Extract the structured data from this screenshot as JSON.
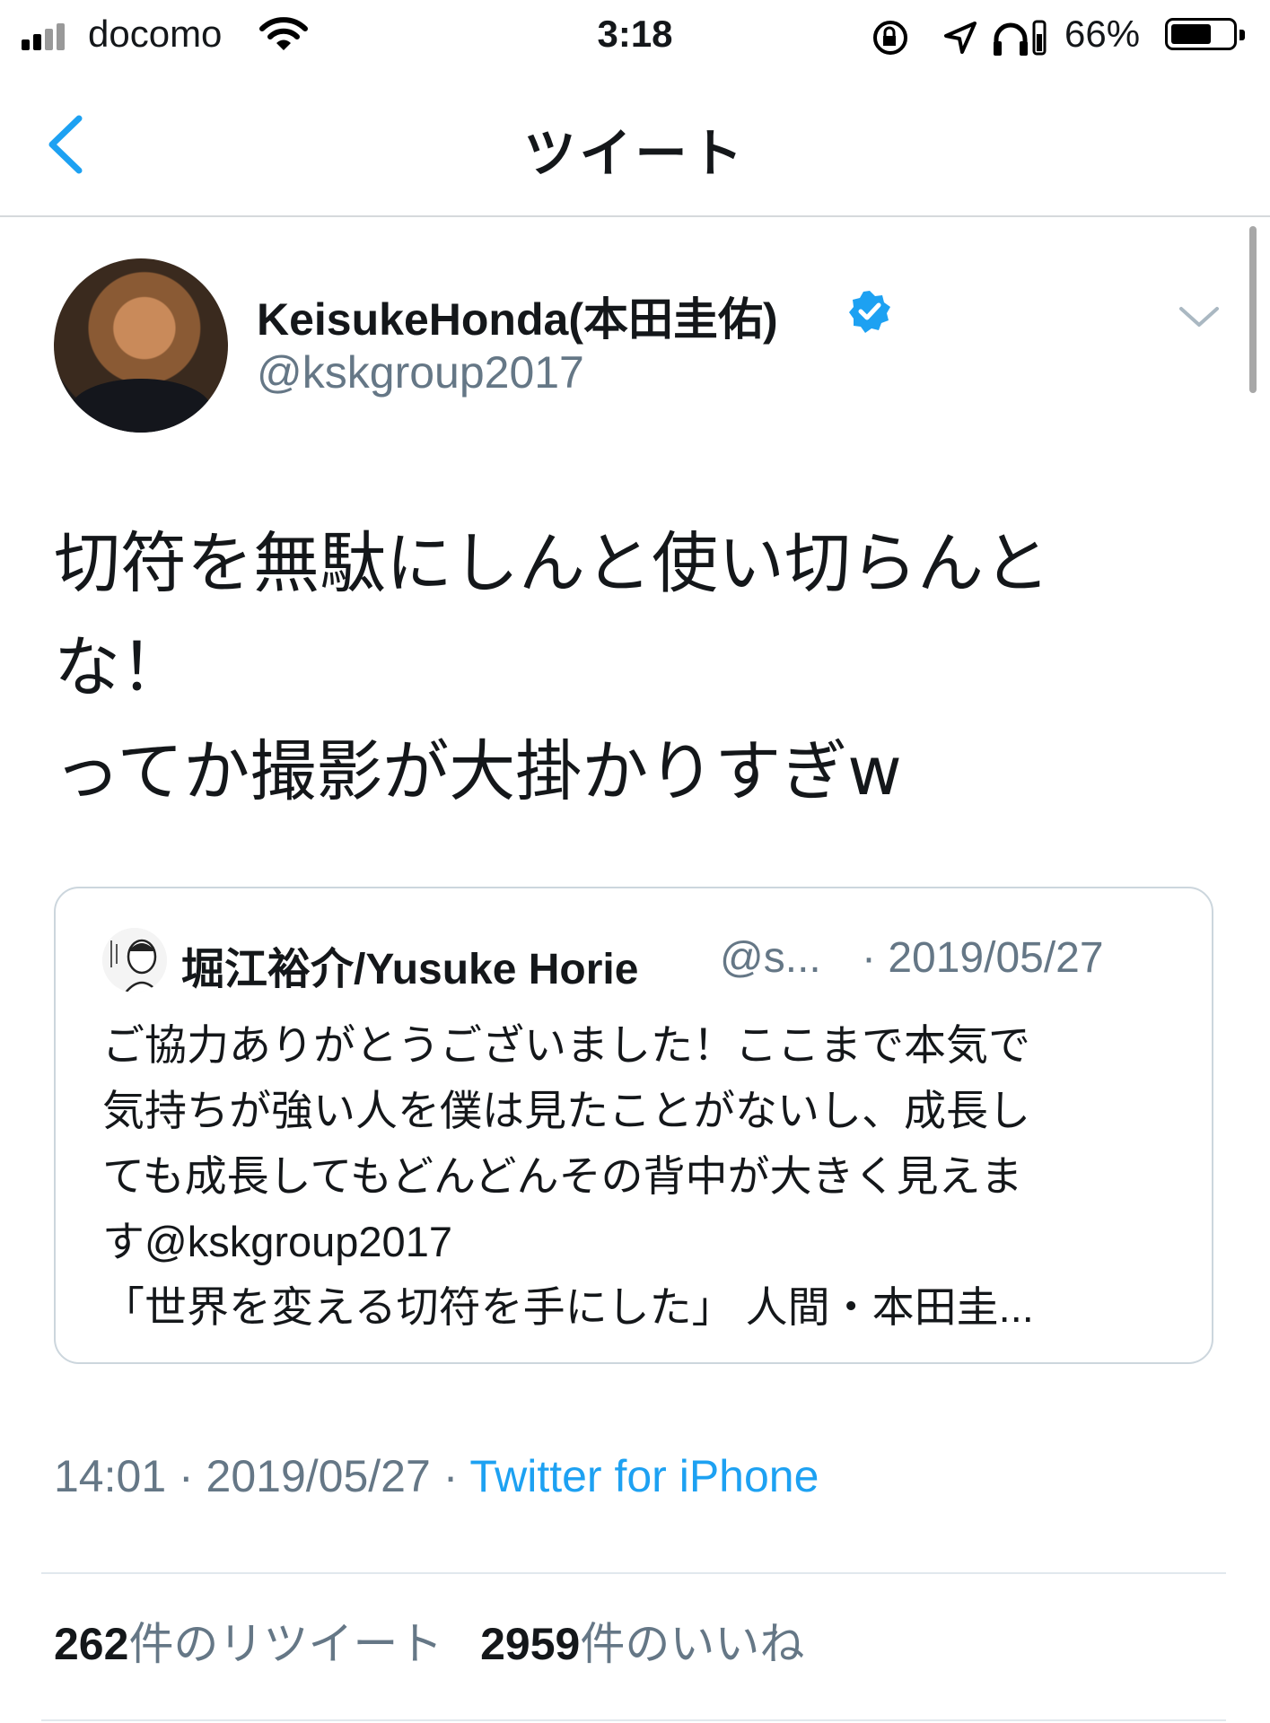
{
  "status_bar": {
    "carrier": "docomo",
    "time": "3:18",
    "battery_percent": "66%",
    "battery_level": 0.66
  },
  "nav": {
    "title": "ツイート"
  },
  "tweet": {
    "display_name": "KeisukeHonda(本田圭佑)",
    "handle": "@kskgroup2017",
    "verified": true,
    "text_lines": [
      "切符を無駄にしんと使い切らんと",
      "な！",
      "ってか撮影が大掛かりすぎw"
    ],
    "quoted": {
      "name": "堀江裕介/Yusuke Horie",
      "handle": "@s...",
      "date": "· 2019/05/27",
      "text_lines": [
        "ご協力ありがとうございました！ここまで本気で",
        "気持ちが強い人を僕は見たことがないし、成長し",
        "ても成長してもどんどんその背中が大きく見えま",
        "す@kskgroup2017",
        "「世界を変える切符を手にした」 人間・本田圭..."
      ]
    },
    "timestamp": "14:01 · 2019/05/27 · ",
    "source": "Twitter for iPhone",
    "retweet_count": "262",
    "retweet_label": "件のリツイート",
    "like_count": "2959",
    "like_label": "件のいいね"
  },
  "colors": {
    "accent": "#1da1f2",
    "secondary_text": "#657786",
    "primary_text": "#14171a"
  },
  "icons": [
    "signal-icon",
    "wifi-icon",
    "orientation-lock-icon",
    "location-icon",
    "headphones-icon",
    "battery-icon",
    "back-chevron-icon",
    "verified-badge-icon",
    "chevron-down-icon"
  ]
}
